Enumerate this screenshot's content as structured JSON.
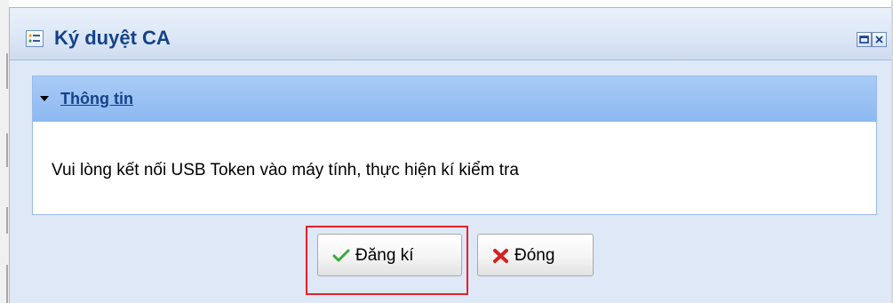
{
  "window": {
    "title": "Ký duyệt CA",
    "title_icon": "form-list-icon",
    "tools": [
      "maximize-icon",
      "close-icon"
    ]
  },
  "panel": {
    "title": "Thông tin",
    "message": "Vui lòng kết nối USB Token vào máy tính, thực hiện kí kiểm tra"
  },
  "buttons": {
    "register_label": "Đăng kí",
    "register_icon": "checkmark-icon",
    "close_label": "Đóng",
    "close_icon": "x-icon"
  },
  "colors": {
    "title_text": "#15428b",
    "panel_header": "#8cb8f1",
    "highlight_border": "#e8202a",
    "check": "#3ca83c",
    "x": "#d82020"
  }
}
